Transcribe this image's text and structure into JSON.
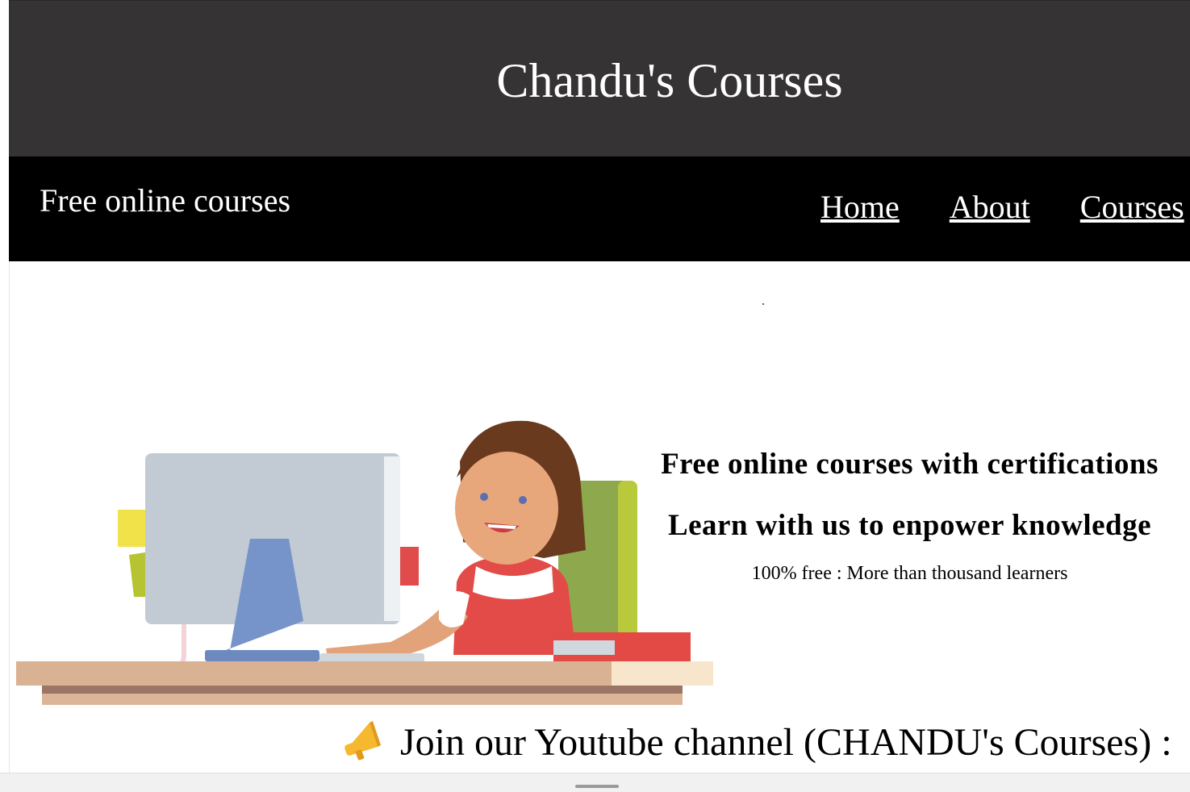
{
  "header": {
    "title": "Chandu's Courses"
  },
  "nav": {
    "tagline": "Free online courses",
    "links": [
      "Home",
      "About",
      "Courses"
    ]
  },
  "hero": {
    "headline": "Free online courses with certifications",
    "subheadline": "Learn with us to enpower knowledge",
    "caption": "100% free : More than thousand learners"
  },
  "announcement": {
    "icon": "megaphone-icon",
    "text": "Join our Youtube channel (CHANDU's Courses) :"
  },
  "colors": {
    "header_bg": "#353334",
    "nav_bg": "#000000",
    "text_light": "#ffffff"
  }
}
